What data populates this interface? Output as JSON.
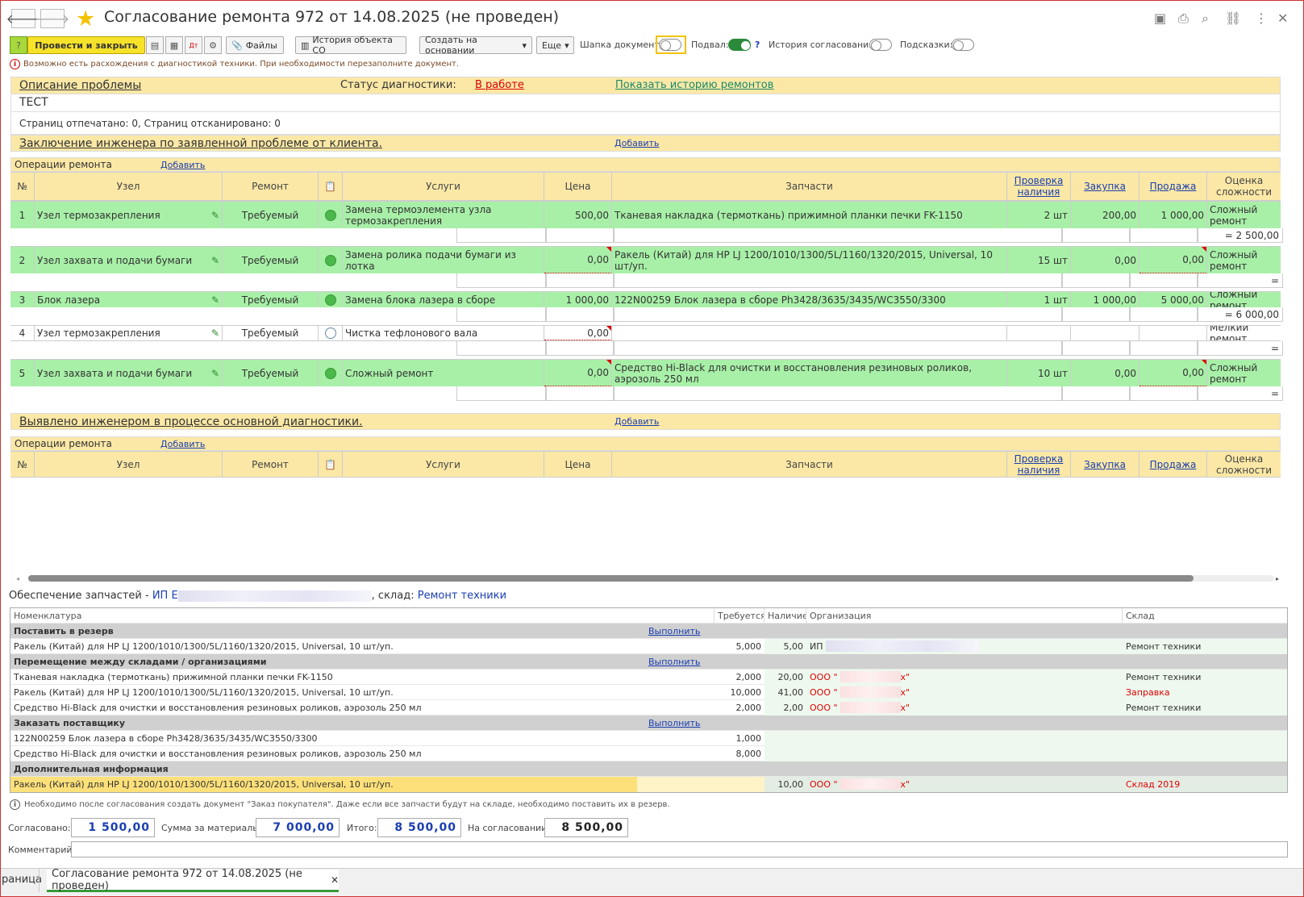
{
  "window": {
    "title": "Согласование ремонта 972 от 14.08.2025 (не проведен)",
    "back_icon": "arrow-left",
    "fwd_icon": "arrow-right"
  },
  "toolbar": {
    "post_close": "Провести и закрыть",
    "files": "Файлы",
    "history_co": "История объекта СО",
    "create_based": "Создать на основании",
    "more": "Еще",
    "doc_header": "Шапка документа:",
    "footer": "Подвал:",
    "footer_help": "?",
    "approval_history": "История согласования:",
    "hints": "Подсказки:"
  },
  "warning": "Возможно есть расхождения с диагностикой техники. При необходимости перезаполните документ.",
  "problem": {
    "title": "Описание проблемы",
    "diag_status_label": "Статус диагностики:",
    "diag_status": "В работе",
    "show_history": "Показать историю ремонтов",
    "text": "ТЕСТ",
    "pages": "Страниц отпечатано: 0, Страниц отсканировано: 0"
  },
  "section1": {
    "title": "Заключение инженера по заявленной проблеме от клиента.",
    "add": "Добавить",
    "ops_label": "Операции ремонта",
    "ops_add": "Добавить"
  },
  "section2": {
    "title": "Выявлено инженером в процессе основной диагностики.",
    "add": "Добавить",
    "ops_label": "Операции ремонта",
    "ops_add": "Добавить"
  },
  "columns": {
    "num": "№",
    "node": "Узел",
    "repair": "Ремонт",
    "services": "Услуги",
    "price": "Цена",
    "parts": "Запчасти",
    "check": "Проверка наличия",
    "purchase": "Закупка",
    "sale": "Продажа",
    "complexity": "Оценка сложности"
  },
  "rows": [
    {
      "n": "1",
      "node": "Узел термозакрепления",
      "repair": "Требуемый",
      "service": "Замена термоэлемента узла термозакрепления",
      "price": "500,00",
      "part": "Тканевая накладка (термоткань) прижимной планки печки FK-1150",
      "qty": "2 шт",
      "purchase": "200,00",
      "sale": "1 000,00",
      "complexity": "Сложный ремонт",
      "total": "= 2 500,00"
    },
    {
      "n": "2",
      "node": "Узел захвата и подачи бумаги",
      "repair": "Требуемый",
      "service": "Замена ролика подачи бумаги из лотка",
      "price": "0,00",
      "part": "Ракель (Китай) для HP LJ 1200/1010/1300/5L/1160/1320/2015, Universal, 10 шт/уп.",
      "qty": "15 шт",
      "purchase": "0,00",
      "sale": "0,00",
      "complexity": "Сложный ремонт",
      "total": "="
    },
    {
      "n": "3",
      "node": "Блок лазера",
      "repair": "Требуемый",
      "service": "Замена блока лазера в сборе",
      "price": "1 000,00",
      "part": "122N00259 Блок лазера в сборе Ph3428/3635/3435/WC3550/3300",
      "qty": "1 шт",
      "purchase": "1 000,00",
      "sale": "5 000,00",
      "complexity": "Сложный ремонт",
      "total": "= 6 000,00"
    },
    {
      "n": "4",
      "node": "Узел термозакрепления",
      "repair": "Требуемый",
      "service": "Чистка тефлонового вала",
      "price": "0,00",
      "part": "",
      "qty": "",
      "purchase": "",
      "sale": "",
      "complexity": "Мелкий ремонт",
      "total": "="
    },
    {
      "n": "5",
      "node": "Узел захвата и подачи бумаги",
      "repair": "Требуемый",
      "service": "Сложный ремонт",
      "price": "0,00",
      "part": "Средство Hi-Black для очистки и восстановления резиновых роликов, аэрозоль 250 мл",
      "qty": "10 шт",
      "purchase": "0,00",
      "sale": "0,00",
      "complexity": "Сложный ремонт",
      "total": "="
    }
  ],
  "supply": {
    "label": "Обеспечение запчастей -",
    "org": "ИП Е",
    "warehouse_label": ", склад:",
    "warehouse": "Ремонт техники",
    "cols": {
      "nom": "Номенклатура",
      "req": "Требуется",
      "avail": "Наличие",
      "org": "Организация",
      "wh": "Склад"
    },
    "run": "Выполнить",
    "groups": [
      {
        "title": "Поставить в резерв",
        "run": true,
        "items": [
          {
            "nom": "Ракель (Китай) для HP LJ 1200/1010/1300/5L/1160/1320/2015, Universal, 10 шт/уп.",
            "req": "5,000",
            "avail": "5,00",
            "org": "ИП",
            "wh": "Ремонт техники",
            "red": false
          }
        ]
      },
      {
        "title": "Перемещение между складами / организациями",
        "run": true,
        "items": [
          {
            "nom": "Тканевая накладка (термоткань) прижимной планки печки FK-1150",
            "req": "2,000",
            "avail": "20,00",
            "org": "ООО \"",
            "org_end": "х\"",
            "wh": "Ремонт техники",
            "red": false
          },
          {
            "nom": "Ракель (Китай) для HP LJ 1200/1010/1300/5L/1160/1320/2015, Universal, 10 шт/уп.",
            "req": "10,000",
            "avail": "41,00",
            "org": "ООО \"",
            "org_end": "х\"",
            "wh": "Заправка",
            "red": true
          },
          {
            "nom": "Средство Hi-Black для очистки и восстановления резиновых роликов, аэрозоль 250 мл",
            "req": "2,000",
            "avail": "2,00",
            "org": "ООО \"",
            "org_end": "х\"",
            "wh": "Ремонт техники",
            "red": false
          }
        ]
      },
      {
        "title": "Заказать поставщику",
        "run": true,
        "items": [
          {
            "nom": "122N00259 Блок лазера в сборе Ph3428/3635/3435/WC3550/3300",
            "req": "1,000",
            "avail": "",
            "org": "",
            "wh": ""
          },
          {
            "nom": "Средство Hi-Black для очистки и восстановления резиновых роликов, аэрозоль 250 мл",
            "req": "8,000",
            "avail": "",
            "org": "",
            "wh": ""
          }
        ]
      },
      {
        "title": "Дополнительная информация",
        "run": false,
        "items": [
          {
            "nom": "Ракель (Китай) для HP LJ 1200/1010/1300/5L/1160/1320/2015, Universal, 10 шт/уп.",
            "req": "",
            "avail": "10,00",
            "org": "ООО \"",
            "org_end": "х\"",
            "wh": "Склад 2019",
            "red": true
          }
        ]
      }
    ]
  },
  "note": "Необходимо после согласования создать документ \"Заказ покупателя\". Даже если все запчасти будут на складе, необходимо поставить их в резерв.",
  "totals": {
    "agreed_label": "Согласовано:",
    "agreed": "1 500,00",
    "materials_label": "Сумма за материалы:",
    "materials": "7 000,00",
    "total_label": "Итого:",
    "total": "8 500,00",
    "pending_label": "На согласовании:",
    "pending": "8 500,00",
    "comment_label": "Комментарий:"
  },
  "tabs": {
    "home": "раница",
    "active": "Согласование ремонта 972 от 14.08.2025 (не проведен)"
  }
}
